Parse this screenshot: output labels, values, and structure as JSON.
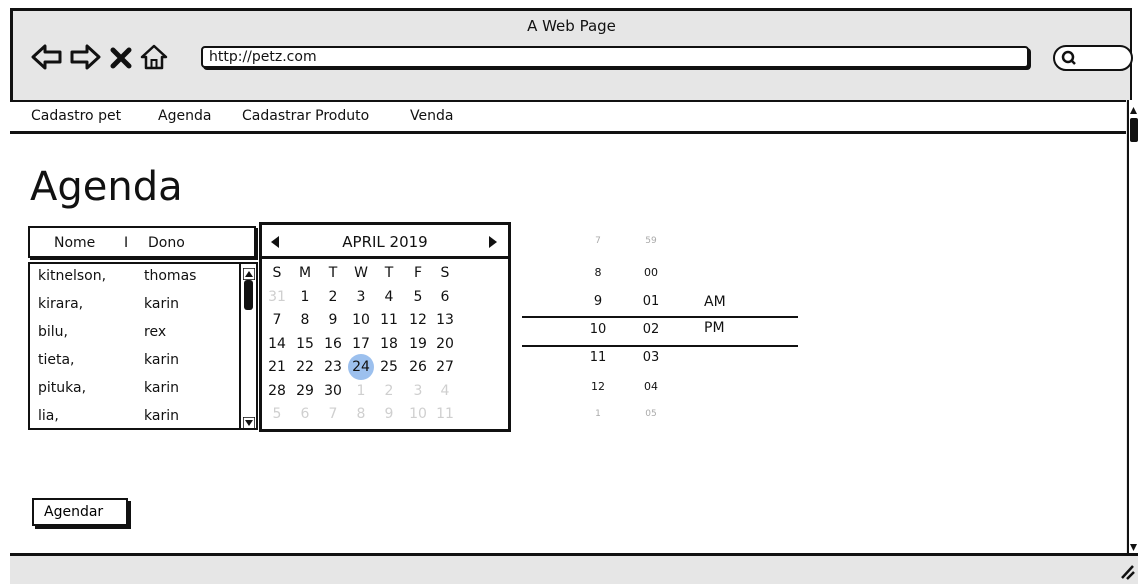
{
  "window": {
    "title": "A Web Page"
  },
  "browser": {
    "url": "http://petz.com"
  },
  "menu": {
    "items": [
      {
        "label": "Cadastro pet"
      },
      {
        "label": "Agenda"
      },
      {
        "label": "Cadastrar Produto"
      },
      {
        "label": "Venda"
      }
    ]
  },
  "page": {
    "title": "Agenda"
  },
  "list": {
    "header": {
      "nome": "Nome",
      "separator": "I",
      "dono": "Dono"
    },
    "rows": [
      {
        "nome": "kitnelson,",
        "dono": "thomas"
      },
      {
        "nome": "kirara,",
        "dono": "karin"
      },
      {
        "nome": "bilu,",
        "dono": "rex"
      },
      {
        "nome": "tieta,",
        "dono": "karin"
      },
      {
        "nome": "pituka,",
        "dono": "karin"
      },
      {
        "nome": "lia,",
        "dono": "karin"
      }
    ]
  },
  "calendar": {
    "month": "APRIL 2019",
    "days_of_week": [
      "S",
      "M",
      "T",
      "W",
      "T",
      "F",
      "S"
    ],
    "selected": "24",
    "weeks": [
      [
        "31",
        "1",
        "2",
        "3",
        "4",
        "5",
        "6"
      ],
      [
        "7",
        "8",
        "9",
        "10",
        "11",
        "12",
        "13"
      ],
      [
        "14",
        "15",
        "16",
        "17",
        "18",
        "19",
        "20"
      ],
      [
        "21",
        "22",
        "23",
        "24",
        "25",
        "26",
        "27"
      ],
      [
        "28",
        "29",
        "30",
        "1",
        "2",
        "3",
        "4"
      ],
      [
        "5",
        "6",
        "7",
        "8",
        "9",
        "10",
        "11"
      ]
    ]
  },
  "time_picker": {
    "hours": [
      "7",
      "8",
      "9",
      "10",
      "11",
      "12",
      "1"
    ],
    "minutes": [
      "59",
      "00",
      "01",
      "02",
      "03",
      "04",
      "05"
    ],
    "ampm": [
      "AM",
      "PM"
    ],
    "selected_hour": "10",
    "selected_minute": "02",
    "selected_ampm": "PM"
  },
  "actions": {
    "agendar": "Agendar"
  }
}
